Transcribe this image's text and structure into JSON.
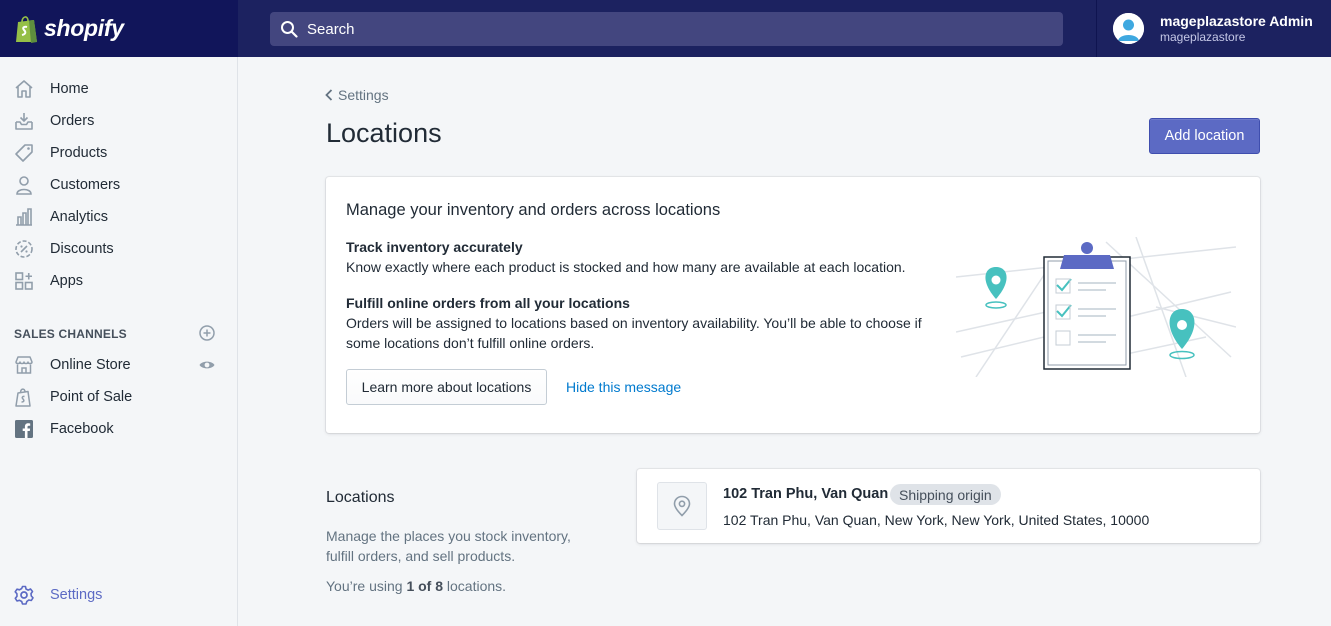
{
  "brand": {
    "name": "shopify"
  },
  "search": {
    "placeholder": "Search"
  },
  "user": {
    "name": "mageplazastore Admin",
    "store": "mageplazastore"
  },
  "sidebar": {
    "items": [
      {
        "label": "Home",
        "icon": "home-icon"
      },
      {
        "label": "Orders",
        "icon": "orders-icon"
      },
      {
        "label": "Products",
        "icon": "tag-icon"
      },
      {
        "label": "Customers",
        "icon": "person-icon"
      },
      {
        "label": "Analytics",
        "icon": "bar-chart-icon"
      },
      {
        "label": "Discounts",
        "icon": "discount-icon"
      },
      {
        "label": "Apps",
        "icon": "apps-icon"
      }
    ],
    "channels_title": "SALES CHANNELS",
    "channels": [
      {
        "label": "Online Store",
        "icon": "store-icon"
      },
      {
        "label": "Point of Sale",
        "icon": "shopping-bag-icon"
      },
      {
        "label": "Facebook",
        "icon": "facebook-icon"
      }
    ],
    "settings_label": "Settings"
  },
  "page": {
    "breadcrumb": "Settings",
    "title": "Locations",
    "add_button": "Add location"
  },
  "banner": {
    "title": "Manage your inventory and orders across locations",
    "track_title": "Track inventory accurately",
    "track_text": "Know exactly where each product is stocked and how many are available at each location.",
    "fulfill_title": "Fulfill online orders from all your locations",
    "fulfill_text": "Orders will be assigned to locations based on inventory availability. You’ll be able to choose if some locations don’t fulfill online orders.",
    "learn_button": "Learn more about locations",
    "hide_link": "Hide this message"
  },
  "locations_section": {
    "heading": "Locations",
    "description": "Manage the places you stock inventory, fulfill orders, and sell products.",
    "usage_prefix": "You’re using ",
    "usage_count": "1 of 8",
    "usage_suffix": " locations."
  },
  "locations": [
    {
      "name": "102 Tran Phu, Van Quan",
      "badge": "Shipping origin",
      "address": "102 Tran Phu, Van Quan, New York, New York, United States, 10000"
    }
  ],
  "colors": {
    "topbar": "#1c2260",
    "accent": "#5c6ac4",
    "link": "#007ace",
    "teal": "#47c1bf"
  }
}
